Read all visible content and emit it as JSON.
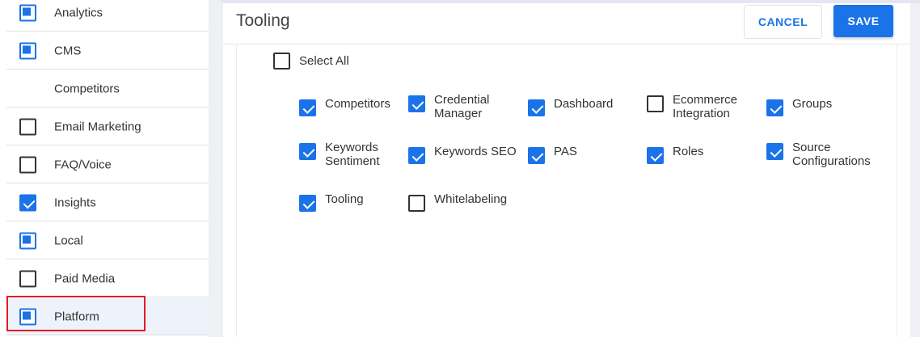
{
  "sidebar": {
    "items": [
      {
        "label": "Analytics",
        "state": "indeterminate"
      },
      {
        "label": "CMS",
        "state": "indeterminate"
      },
      {
        "label": "Competitors",
        "state": "none"
      },
      {
        "label": "Email Marketing",
        "state": "unchecked"
      },
      {
        "label": "FAQ/Voice",
        "state": "unchecked"
      },
      {
        "label": "Insights",
        "state": "checked"
      },
      {
        "label": "Local",
        "state": "indeterminate"
      },
      {
        "label": "Paid Media",
        "state": "unchecked"
      },
      {
        "label": "Platform",
        "state": "indeterminate"
      }
    ]
  },
  "panel": {
    "title": "Tooling",
    "cancel_label": "CANCEL",
    "save_label": "SAVE",
    "select_all_label": "Select All"
  },
  "permissions": [
    {
      "label": "Competitors",
      "checked": true
    },
    {
      "label": "Credential Manager",
      "checked": true
    },
    {
      "label": "Dashboard",
      "checked": true
    },
    {
      "label": "Ecommerce Integration",
      "checked": false
    },
    {
      "label": "Groups",
      "checked": true
    },
    {
      "label": "Keywords Sentiment",
      "checked": true
    },
    {
      "label": "Keywords SEO",
      "checked": true
    },
    {
      "label": "PAS",
      "checked": true
    },
    {
      "label": "Roles",
      "checked": true
    },
    {
      "label": "Source Configurations",
      "checked": true
    },
    {
      "label": "Tooling",
      "checked": true
    },
    {
      "label": "Whitelabeling",
      "checked": false
    }
  ],
  "colors": {
    "accent": "#1a73e8",
    "highlight": "#e01b24"
  }
}
